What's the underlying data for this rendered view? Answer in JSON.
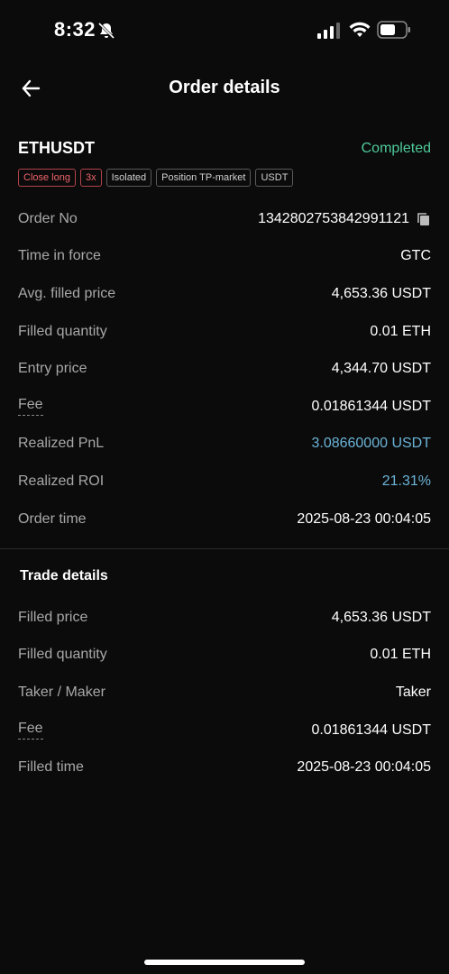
{
  "status_bar": {
    "time": "8:32"
  },
  "nav": {
    "title": "Order details"
  },
  "order": {
    "symbol": "ETHUSDT",
    "status": "Completed",
    "tags": [
      "Close long",
      "3x",
      "Isolated",
      "Position TP-market",
      "USDT"
    ],
    "rows": [
      {
        "label": "Order No",
        "value": "1342802753842991121"
      },
      {
        "label": "Time in force",
        "value": "GTC"
      },
      {
        "label": "Avg. filled price",
        "value": "4,653.36 USDT"
      },
      {
        "label": "Filled quantity",
        "value": "0.01 ETH"
      },
      {
        "label": "Entry price",
        "value": "4,344.70 USDT"
      },
      {
        "label": "Fee",
        "value": "0.01861344 USDT"
      },
      {
        "label": "Realized PnL",
        "value": "3.08660000 USDT"
      },
      {
        "label": "Realized ROI",
        "value": "21.31%"
      },
      {
        "label": "Order time",
        "value": "2025-08-23 00:04:05"
      }
    ]
  },
  "trade": {
    "title": "Trade details",
    "rows": [
      {
        "label": "Filled price",
        "value": "4,653.36 USDT"
      },
      {
        "label": "Filled quantity",
        "value": "0.01 ETH"
      },
      {
        "label": "Taker / Maker",
        "value": "Taker"
      },
      {
        "label": "Fee",
        "value": "0.01861344 USDT"
      },
      {
        "label": "Filled time",
        "value": "2025-08-23 00:04:05"
      }
    ]
  },
  "colors": {
    "background": "#0b0b0b",
    "status_green": "#4ecb9a",
    "pnl_blue": "#6bb4d8",
    "tag_red": "#f0646a"
  }
}
